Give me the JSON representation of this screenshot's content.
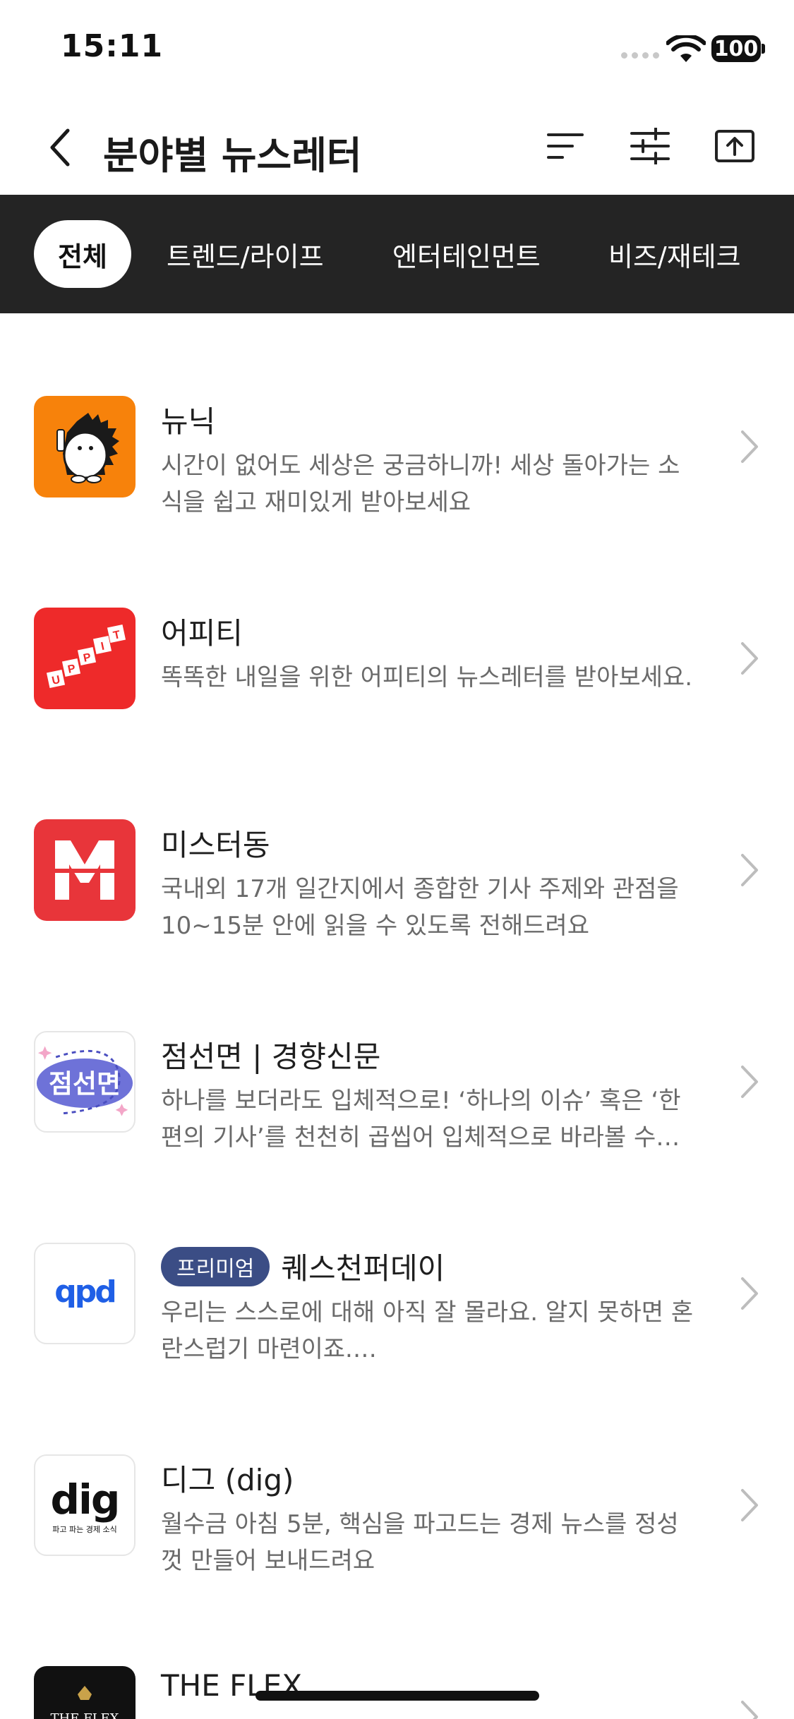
{
  "status_bar": {
    "time": "15:11",
    "battery": "100"
  },
  "header": {
    "title": "분야별 뉴스레터"
  },
  "tabs": [
    {
      "label": "전체",
      "active": true
    },
    {
      "label": "트렌드/라이프",
      "active": false
    },
    {
      "label": "엔터테인먼트",
      "active": false
    },
    {
      "label": "비즈/재테크",
      "active": false
    }
  ],
  "newsletters": [
    {
      "title": "뉴닉",
      "badge": "",
      "desc": "시간이 없어도 세상은 궁금하니까! 세상 돌아가는 소식을 쉽고 재미있게 받아보세요",
      "icon": "newneek-hedgehog-logo"
    },
    {
      "title": "어피티",
      "badge": "",
      "desc": "똑똑한 내일을 위한 어피티의 뉴스레터를 받아보세요.",
      "icon": "uppity-logo"
    },
    {
      "title": "미스터동",
      "badge": "",
      "desc": "국내외 17개 일간지에서 종합한 기사 주제와 관점을 10~15분 안에 읽을 수 있도록 전해드려요",
      "icon": "mrdong-logo"
    },
    {
      "title": "점선면 | 경향신문",
      "badge": "",
      "desc": "하나를 보더라도 입체적으로! ‘하나의 이슈’ 혹은 ‘한 편의 기사’를 천천히 곱씹어 입체적으로 바라볼 수…",
      "icon": "jeomseonmyeon-logo"
    },
    {
      "title": "퀘스천퍼데이",
      "badge": "프리미엄",
      "desc": "우리는 스스로에 대해 아직 잘 몰라요. 알지 못하면 혼란스럽기 마련이죠.…",
      "icon": "qpd-logo"
    },
    {
      "title": "디그 (dig)",
      "badge": "",
      "desc": "월수금 아침 5분, 핵심을 파고드는 경제 뉴스를 정성껏 만들어 보내드려요",
      "icon": "dig-logo"
    },
    {
      "title": "THE FLEX",
      "badge": "",
      "desc": "",
      "icon": "theflex-logo"
    }
  ],
  "logos": {
    "uppity_text": "UPPITY",
    "mrdong_letter": "M",
    "jeomseonmyeon_text": "점선면",
    "qpd_text": "qpd",
    "dig_text": "dig",
    "dig_tagline": "파고 파는 경제 소식",
    "theflex_text": "THE FLEX"
  },
  "colors": {
    "tab_bar_bg": "#242424",
    "newneek_orange": "#f7820b",
    "uppity_red": "#ee2a2a",
    "mrdong_red": "#e8353a",
    "jsm_purple": "#6e72d8",
    "qpd_blue": "#1f5fe6",
    "premium_badge": "#3b4d85"
  }
}
